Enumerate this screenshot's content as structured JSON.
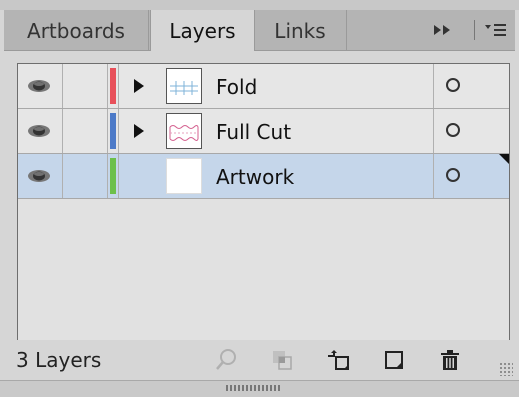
{
  "tabs": [
    {
      "label": "Artboards"
    },
    {
      "label": "Layers"
    },
    {
      "label": "Links"
    }
  ],
  "tab_controls": {
    "expand_glyph": "▸▸",
    "menu_glyph": "▾≡"
  },
  "layers": [
    {
      "name": "Fold",
      "color": "#e8505a",
      "expandable": true,
      "thumb": "fold-thumb"
    },
    {
      "name": "Full Cut",
      "color": "#4c7ac8",
      "expandable": true,
      "thumb": "fullcut-thumb"
    },
    {
      "name": "Artwork",
      "color": "#6dc04a",
      "expandable": false,
      "thumb": "blank-thumb",
      "selected": true
    }
  ],
  "footer": {
    "count_label": "3 Layers"
  }
}
